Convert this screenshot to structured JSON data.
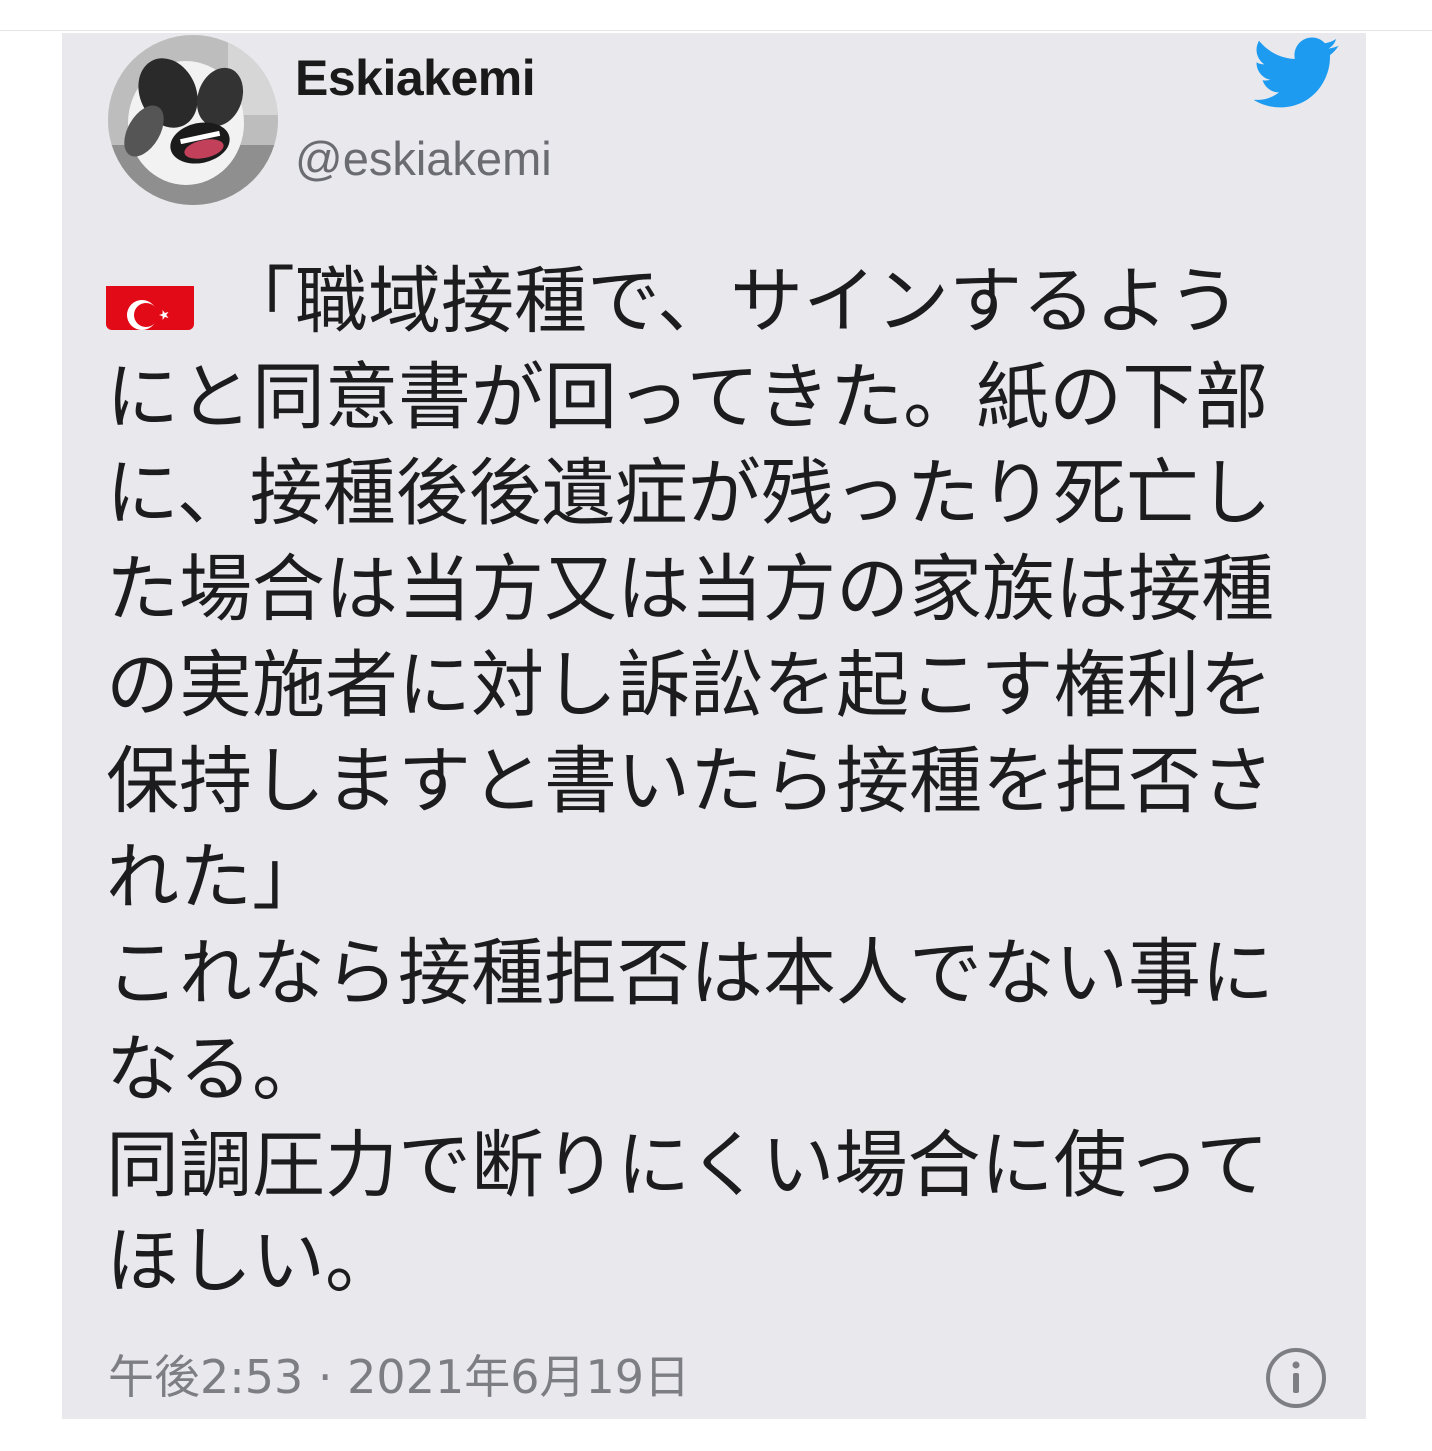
{
  "author": {
    "display_name": "Eskiakemi",
    "handle": "@eskiakemi"
  },
  "icons": {
    "avatar": "dog-avatar",
    "brand": "twitter-bird-icon",
    "flag": "turkey-flag-icon",
    "info": "info-icon"
  },
  "tweet": {
    "lines": [
      "「職域接種で、サインするよう",
      "にと同意書が回ってきた。紙の下部",
      "に、接種後後遺症が残ったり死亡し",
      "た場合は当方又は当方の家族は接種",
      "の実施者に対し訴訟を起こす権利を",
      "保持しますと書いたら接種を拒否さ",
      "れた」",
      "これなら接種拒否は本人でない事に",
      "なる。",
      "同調圧力で断りにくい場合に使って",
      "ほしい。"
    ]
  },
  "timestamp": "午後2:53 · 2021年6月19日",
  "colors": {
    "card_background": "#e8e8ed",
    "twitter_blue": "#1d9bf0",
    "flag_red": "#e30a17",
    "text": "#1c1c1e",
    "muted_text": "#6b6b72"
  }
}
